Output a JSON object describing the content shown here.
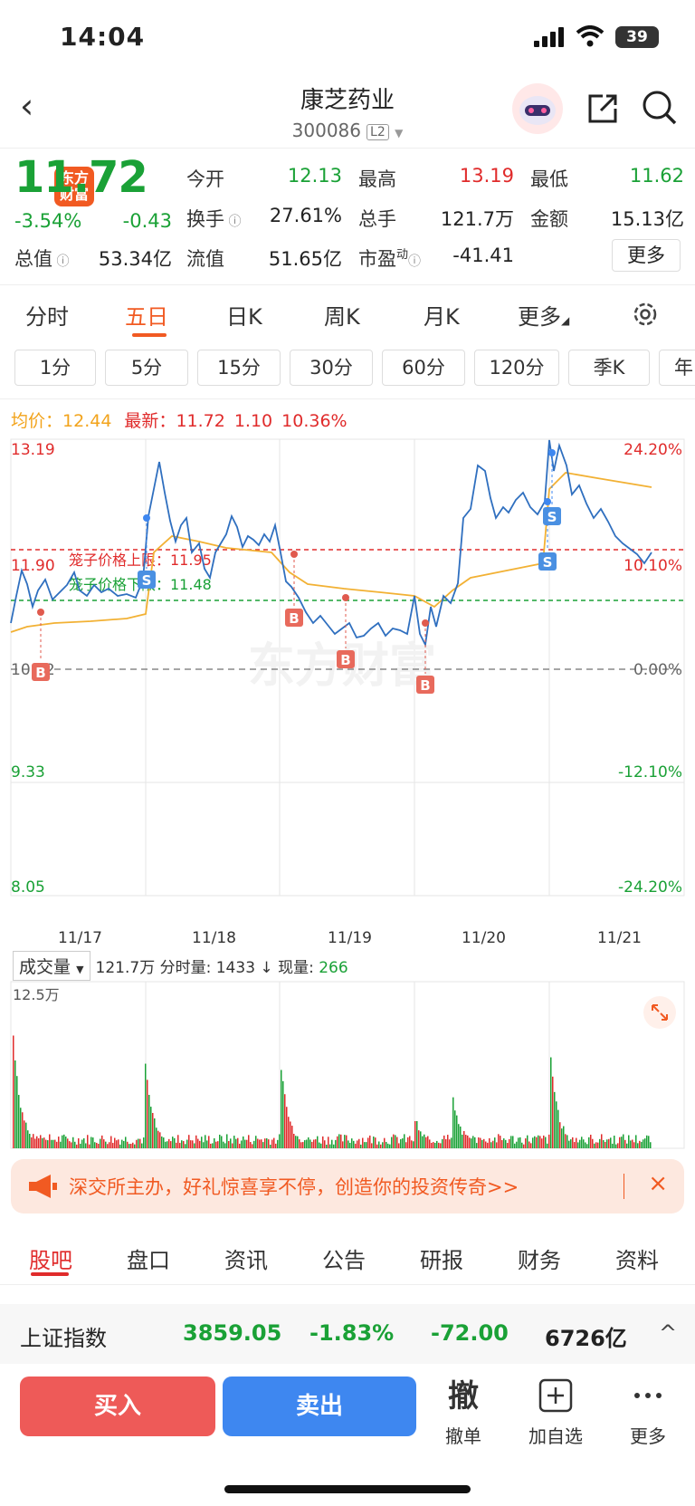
{
  "status": {
    "time": "14:04",
    "battery": "39"
  },
  "nav": {
    "logo": "东方财富",
    "name": "康芝药业",
    "code": "300086",
    "l2": "L2"
  },
  "quote": {
    "price": "11.72",
    "pct": "-3.54%",
    "chg": "-0.43",
    "open_l": "今开",
    "open": "12.13",
    "high_l": "最高",
    "high": "13.19",
    "low_l": "最低",
    "low": "11.62",
    "turn_l": "换手",
    "turn": "27.61%",
    "vol_l": "总手",
    "vol": "121.7万",
    "amt_l": "金额",
    "amt": "15.13亿",
    "cap_l": "总值",
    "cap": "53.34亿",
    "float_l": "流值",
    "float": "51.65亿",
    "pe_l": "市盈",
    "pe_sup": "动",
    "pe": "-41.41",
    "more": "更多"
  },
  "period_tabs": [
    "分时",
    "五日",
    "日K",
    "周K",
    "月K",
    "更多"
  ],
  "interval_buttons": [
    "1分",
    "5分",
    "15分",
    "30分",
    "60分",
    "120分",
    "季K",
    "年"
  ],
  "legend": {
    "avg_l": "均价：",
    "avg": "12.44",
    "last_l": "最新：",
    "last": "11.72",
    "chg": "1.10",
    "pct": "10.36%"
  },
  "chart_data": {
    "type": "line",
    "x": [
      "11/17",
      "11/18",
      "11/19",
      "11/20",
      "11/21"
    ],
    "y_left": [
      "13.19",
      "11.90",
      "10.62",
      "9.33",
      "8.05"
    ],
    "y_right": [
      "24.20%",
      "10.10%",
      "0.00%",
      "-12.10%",
      "-24.20%"
    ],
    "ylim": [
      8.05,
      13.19
    ],
    "cage_upper_label": "笼子价格上限：11.95",
    "cage_lower_label": "笼子价格下限：11.48",
    "series": [],
    "markers": [
      "B",
      "S",
      "B",
      "B",
      "B",
      "S",
      "S"
    ],
    "watermark": "东方财富"
  },
  "volume": {
    "selector": "成交量",
    "total": "121.7万",
    "detail": "分时量: 1433",
    "arrow": "↓",
    "now_l": "现量:",
    "now": "266",
    "max": "12.5万"
  },
  "banner": {
    "text": "深交所主办，好礼惊喜享不停，创造你的投资传奇>>",
    "close": "×"
  },
  "bottom_tabs": [
    "股吧",
    "盘口",
    "资讯",
    "公告",
    "研报",
    "财务",
    "资料"
  ],
  "index": {
    "name": "上证指数",
    "value": "3859.05",
    "pct": "-1.83%",
    "chg": "-72.00",
    "amt": "6726亿",
    "arrow": "^"
  },
  "actions": {
    "buy": "买入",
    "sell": "卖出",
    "cancel_icon": "撤",
    "cancel": "撤单",
    "add": "加自选",
    "more": "更多"
  }
}
